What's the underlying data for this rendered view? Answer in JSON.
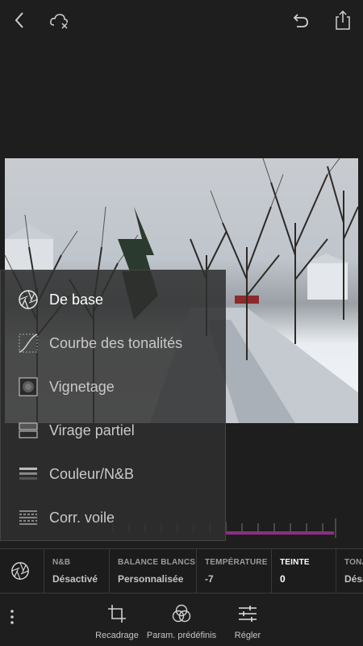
{
  "toolbar": {
    "back_icon": "chevron-left-icon",
    "cloud_icon": "cloud-off-icon",
    "undo_icon": "undo-icon",
    "share_icon": "share-icon"
  },
  "menu": {
    "items": [
      {
        "label": "De base",
        "icon": "aperture-icon",
        "active": true
      },
      {
        "label": "Courbe des tonalités",
        "icon": "tone-curve-icon",
        "active": false
      },
      {
        "label": "Vignetage",
        "icon": "vignette-icon",
        "active": false
      },
      {
        "label": "Virage partiel",
        "icon": "split-toning-icon",
        "active": false
      },
      {
        "label": "Couleur/N&B",
        "icon": "color-bw-icon",
        "active": false
      },
      {
        "label": "Corr. voile",
        "icon": "dehaze-icon",
        "active": false
      }
    ]
  },
  "params": {
    "icon": "aperture-icon",
    "cells": [
      {
        "title": "N&B",
        "value": "Désactivé"
      },
      {
        "title": "BALANCE BLANCS",
        "value": "Personnalisée"
      },
      {
        "title": "TEMPÉRATURE",
        "value": "-7"
      },
      {
        "title": "TEINTE",
        "value": "0",
        "active": true
      },
      {
        "title": "TONA",
        "value": "Désa"
      }
    ]
  },
  "bottom_nav": {
    "more_icon": "more-vertical-icon",
    "items": [
      {
        "label": "Recadrage",
        "icon": "crop-icon"
      },
      {
        "label": "Param. prédéfinis",
        "icon": "presets-icon"
      },
      {
        "label": "Régler",
        "icon": "sliders-icon"
      }
    ]
  },
  "colors": {
    "background": "#1e1e1e",
    "accent_slider": "#8a2f82",
    "text_active": "#ffffff",
    "text_default": "#c9c9c9"
  }
}
